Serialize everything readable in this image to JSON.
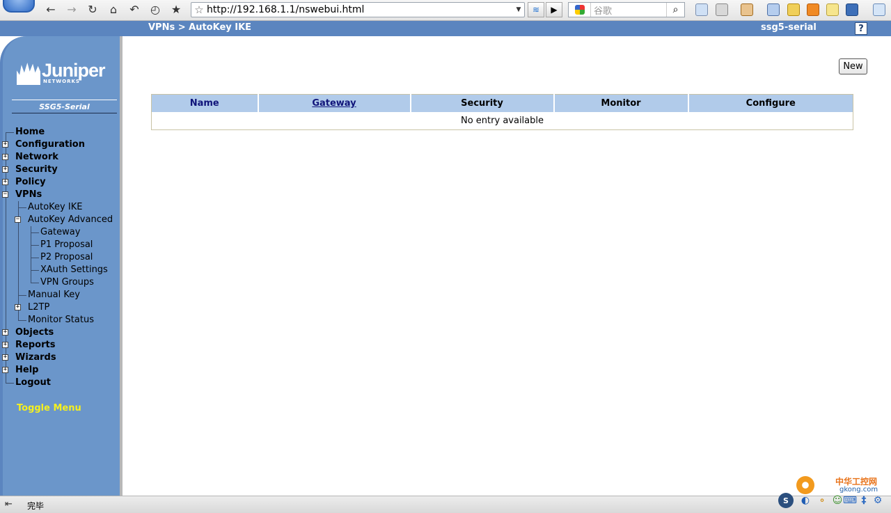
{
  "browser": {
    "url": "http://192.168.1.1/nswebui.html",
    "search_placeholder": "谷歌",
    "status_text": "完毕"
  },
  "header": {
    "breadcrumb": "VPNs > AutoKey IKE",
    "device_name": "ssg5-serial",
    "help_label": "?"
  },
  "sidebar": {
    "logo_text": "Juniper",
    "logo_sub": "NETWORKS",
    "model": "SSG5-Serial",
    "nav": {
      "home": "Home",
      "configuration": "Configuration",
      "network": "Network",
      "security": "Security",
      "policy": "Policy",
      "vpns": "VPNs",
      "autokey_ike": "AutoKey IKE",
      "autokey_advanced": "AutoKey Advanced",
      "gateway": "Gateway",
      "p1_proposal": "P1 Proposal",
      "p2_proposal": "P2 Proposal",
      "xauth_settings": "XAuth Settings",
      "vpn_groups": "VPN Groups",
      "manual_key": "Manual Key",
      "l2tp": "L2TP",
      "monitor_status": "Monitor Status",
      "objects": "Objects",
      "reports": "Reports",
      "wizards": "Wizards",
      "help": "Help",
      "logout": "Logout"
    },
    "toggle_menu": "Toggle Menu"
  },
  "main": {
    "new_button": "New",
    "table": {
      "headers": [
        "Name",
        "Gateway",
        "Security",
        "Monitor",
        "Configure"
      ],
      "empty_message": "No entry available"
    }
  },
  "watermark": {
    "line1": "中华工控网",
    "line2": "gkong.com"
  },
  "colors": {
    "sidebar_bg": "#6b96ca",
    "header_bg": "#5b85bf",
    "table_header_bg": "#b1cbea",
    "toggle_menu": "#f5f01f"
  }
}
